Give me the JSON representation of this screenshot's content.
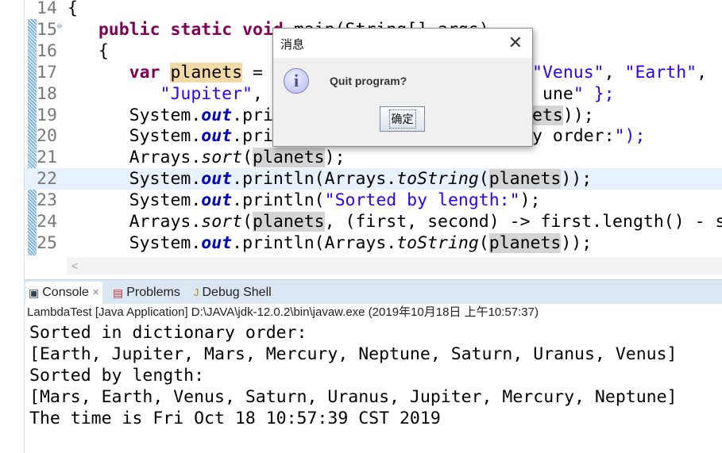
{
  "editor": {
    "lines": [
      {
        "num": "14",
        "left": "{",
        "right": ""
      },
      {
        "num": "15",
        "left": "   public static void main(String[] args)",
        "right": ""
      },
      {
        "num": "16",
        "left": "   {",
        "right": ""
      },
      {
        "num": "17",
        "left": "      var planets = ",
        "right": "\"Venus\", \"Earth\","
      },
      {
        "num": "18",
        "left": "         \"Jupiter\",",
        "right": "une\" };"
      },
      {
        "num": "19",
        "left": "      System.out.pri",
        "right": "ets));"
      },
      {
        "num": "20",
        "left": "      System.out.pri",
        "right": "y order:\");"
      },
      {
        "num": "21",
        "left": "      Arrays.sort(planets);",
        "right": ""
      },
      {
        "num": "22",
        "left": "      System.out.println(Arrays.toString(planets));",
        "right": ""
      },
      {
        "num": "23",
        "left": "      System.out.println(\"Sorted by length:\");",
        "right": ""
      },
      {
        "num": "24",
        "left": "      Arrays.sort(planets, (first, second) -> first.length() - s",
        "right": ""
      },
      {
        "num": "25",
        "left": "      System.out.println(Arrays.toString(planets));",
        "right": ""
      }
    ],
    "scroll_left": "<"
  },
  "tabs": [
    {
      "label": "Console",
      "icon": "console-icon",
      "close": "✕"
    },
    {
      "label": "Problems",
      "icon": "problems-icon"
    },
    {
      "label": "Debug Shell",
      "icon": "debug-shell-icon"
    }
  ],
  "console": {
    "info": "LambdaTest [Java Application] D:\\JAVA\\jdk-12.0.2\\bin\\javaw.exe (2019年10月18日 上午10:57:37)",
    "output": [
      "Sorted in dictionary order:",
      "[Earth, Jupiter, Mars, Mercury, Neptune, Saturn, Uranus, Venus]",
      "Sorted by length:",
      "[Mars, Earth, Venus, Saturn, Uranus, Jupiter, Mercury, Neptune]",
      "The time is Fri Oct 18 10:57:39 CST 2019"
    ]
  },
  "dialog": {
    "title": "消息",
    "close": "✕",
    "icon": "info-icon",
    "message": "Quit program?",
    "ok_label": "确定"
  },
  "colors": {
    "keyword": "#7f0055",
    "string": "#2a00ff",
    "field": "#0000c0",
    "current_line": "#e8f2fe"
  }
}
